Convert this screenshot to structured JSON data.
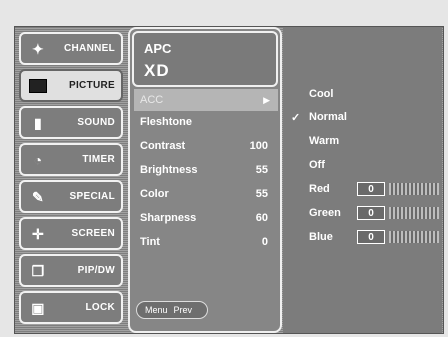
{
  "menu": {
    "items": [
      {
        "label": "CHANNEL",
        "icon": "antenna-icon",
        "active": false
      },
      {
        "label": "PICTURE",
        "icon": "picture-icon",
        "active": true
      },
      {
        "label": "SOUND",
        "icon": "speaker-icon",
        "active": false
      },
      {
        "label": "TIMER",
        "icon": "clock-icon",
        "active": false
      },
      {
        "label": "SPECIAL",
        "icon": "wrench-icon",
        "active": false
      },
      {
        "label": "SCREEN",
        "icon": "crosshair-icon",
        "active": false
      },
      {
        "label": "PIP/DW",
        "icon": "pip-icon",
        "active": false
      },
      {
        "label": "LOCK",
        "icon": "lock-icon",
        "active": false
      }
    ]
  },
  "picture": {
    "header": {
      "title": "APC",
      "logo": "XD"
    },
    "settings": [
      {
        "label": "ACC",
        "value": "",
        "selected": true,
        "arrow": "▶"
      },
      {
        "label": "Fleshtone",
        "value": ""
      },
      {
        "label": "Contrast",
        "value": "100"
      },
      {
        "label": "Brightness",
        "value": "55"
      },
      {
        "label": "Color",
        "value": "55"
      },
      {
        "label": "Sharpness",
        "value": "60"
      },
      {
        "label": "Tint",
        "value": "0"
      }
    ],
    "nav": {
      "menu_label": "Menu",
      "prev_label": "Prev"
    }
  },
  "acc_options": {
    "checkmark": "✓",
    "modes": [
      {
        "label": "Cool",
        "checked": false
      },
      {
        "label": "Normal",
        "checked": true
      },
      {
        "label": "Warm",
        "checked": false
      },
      {
        "label": "Off",
        "checked": false
      }
    ],
    "rgb": [
      {
        "label": "Red",
        "value": "0"
      },
      {
        "label": "Green",
        "value": "0"
      },
      {
        "label": "Blue",
        "value": "0"
      }
    ]
  },
  "colors": {
    "panel": "#868686",
    "highlight": "#b5b5b5",
    "text": "#ffffff"
  }
}
